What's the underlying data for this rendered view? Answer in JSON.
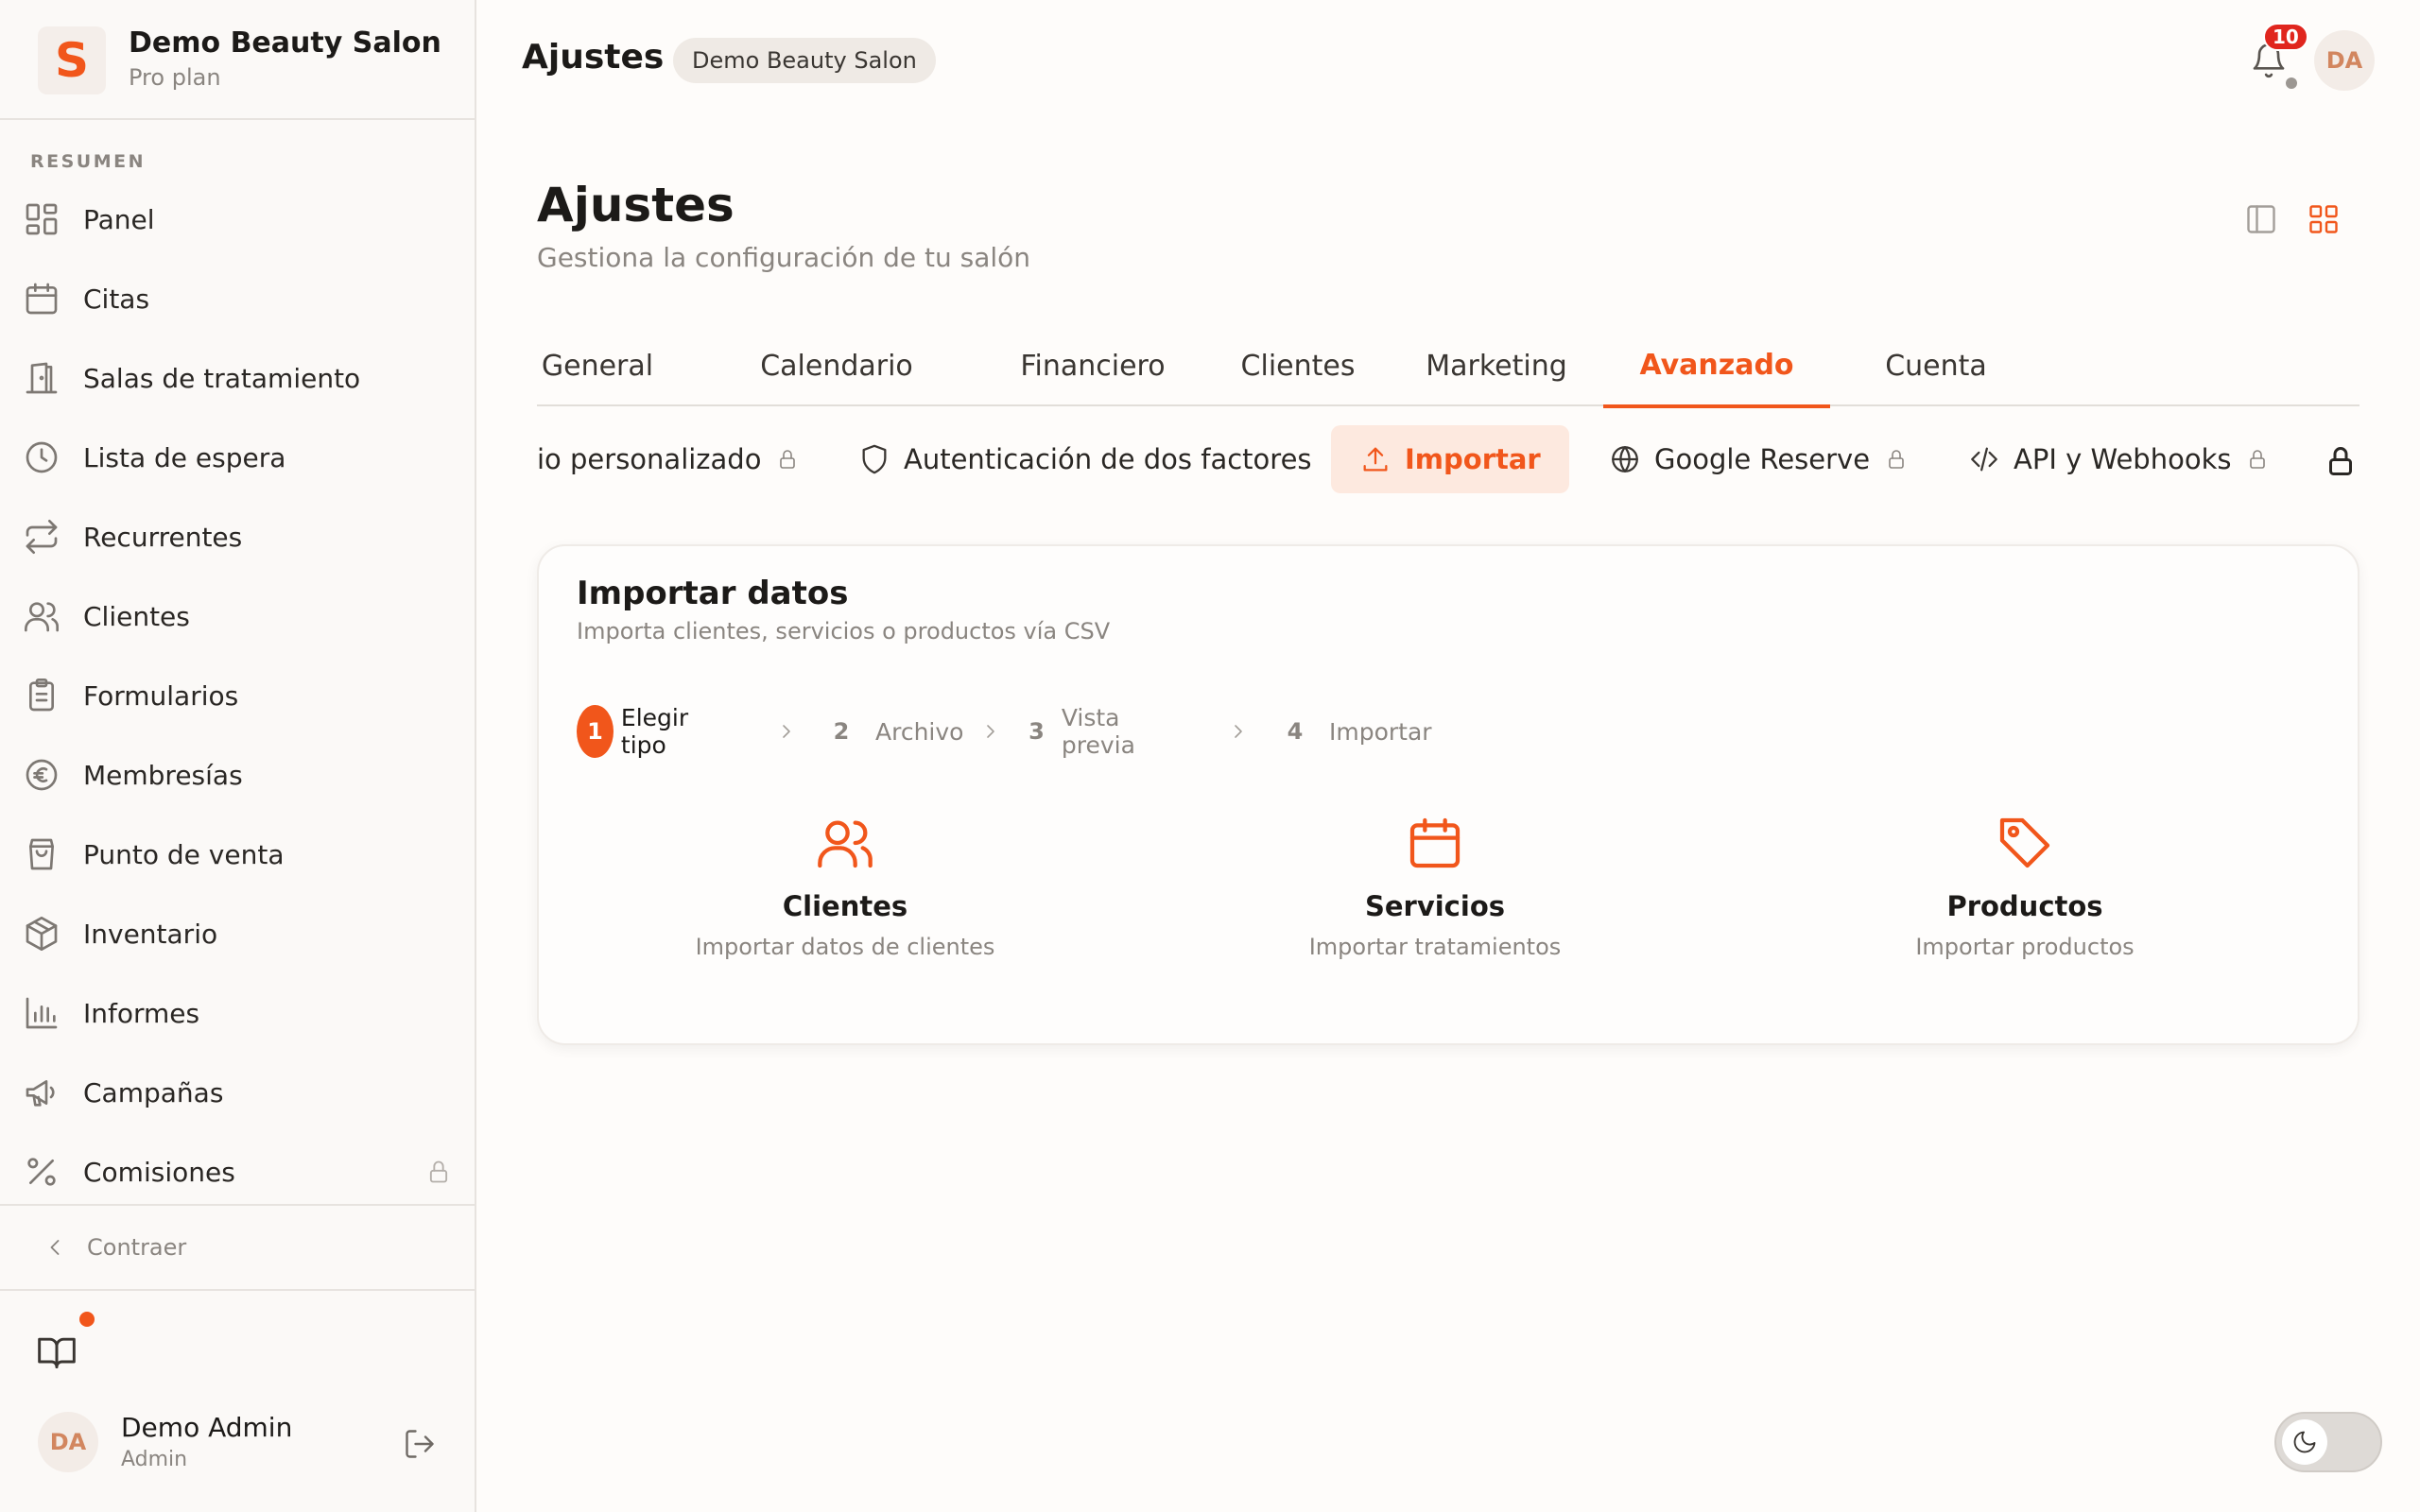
{
  "brand": {
    "name": "Demo Beauty Salon",
    "plan": "Pro plan",
    "logo_letter": "S"
  },
  "sidebar": {
    "section_label": "RESUMEN",
    "items": [
      {
        "label": "Panel",
        "icon": "grid-icon"
      },
      {
        "label": "Citas",
        "icon": "calendar-icon"
      },
      {
        "label": "Salas de tratamiento",
        "icon": "door-icon"
      },
      {
        "label": "Lista de espera",
        "icon": "clock-icon"
      },
      {
        "label": "Recurrentes",
        "icon": "repeat-icon"
      },
      {
        "label": "Clientes",
        "icon": "users-icon"
      },
      {
        "label": "Formularios",
        "icon": "clipboard-icon"
      },
      {
        "label": "Membresías",
        "icon": "euro-icon"
      },
      {
        "label": "Punto de venta",
        "icon": "shopping-bag-icon"
      },
      {
        "label": "Inventario",
        "icon": "box-icon"
      },
      {
        "label": "Informes",
        "icon": "bar-chart-icon"
      },
      {
        "label": "Campañas",
        "icon": "megaphone-icon"
      },
      {
        "label": "Comisiones",
        "icon": "percent-icon",
        "locked": true
      }
    ],
    "collapse_label": "Contraer"
  },
  "user": {
    "initials": "DA",
    "name": "Demo Admin",
    "role": "Admin"
  },
  "topbar": {
    "title": "Ajustes",
    "salon_badge": "Demo Beauty Salon",
    "notification_count": "10",
    "avatar_initials": "DA"
  },
  "page": {
    "title": "Ajustes",
    "subtitle": "Gestiona la configuración de tu salón"
  },
  "tabs": [
    "General",
    "Calendario",
    "Financiero",
    "Clientes",
    "Marketing",
    "Avanzado",
    "Cuenta"
  ],
  "active_tab": "Avanzado",
  "subtabs": [
    {
      "label": "io personalizado",
      "locked": true
    },
    {
      "label": "Autenticación de dos factores",
      "icon": "shield-icon"
    },
    {
      "label": "Importar",
      "icon": "upload-icon",
      "active": true
    },
    {
      "label": "Google Reserve",
      "icon": "globe-icon",
      "locked": true
    },
    {
      "label": "API y Webhooks",
      "icon": "code-icon",
      "locked": true
    }
  ],
  "import_card": {
    "title": "Importar datos",
    "subtitle": "Importa clientes, servicios o productos vía CSV",
    "steps": [
      {
        "num": "1",
        "label": "Elegir tipo",
        "active": true
      },
      {
        "num": "2",
        "label": "Archivo"
      },
      {
        "num": "3",
        "label": "Vista previa"
      },
      {
        "num": "4",
        "label": "Importar"
      }
    ],
    "options": [
      {
        "title": "Clientes",
        "subtitle": "Importar datos de clientes",
        "icon": "users-icon"
      },
      {
        "title": "Servicios",
        "subtitle": "Importar tratamientos",
        "icon": "calendar-icon"
      },
      {
        "title": "Productos",
        "subtitle": "Importar productos",
        "icon": "tag-icon"
      }
    ]
  },
  "colors": {
    "accent": "#f1561b",
    "accent_soft": "#fde9df",
    "badge_red": "#e0261e",
    "background": "#fefcfa"
  }
}
